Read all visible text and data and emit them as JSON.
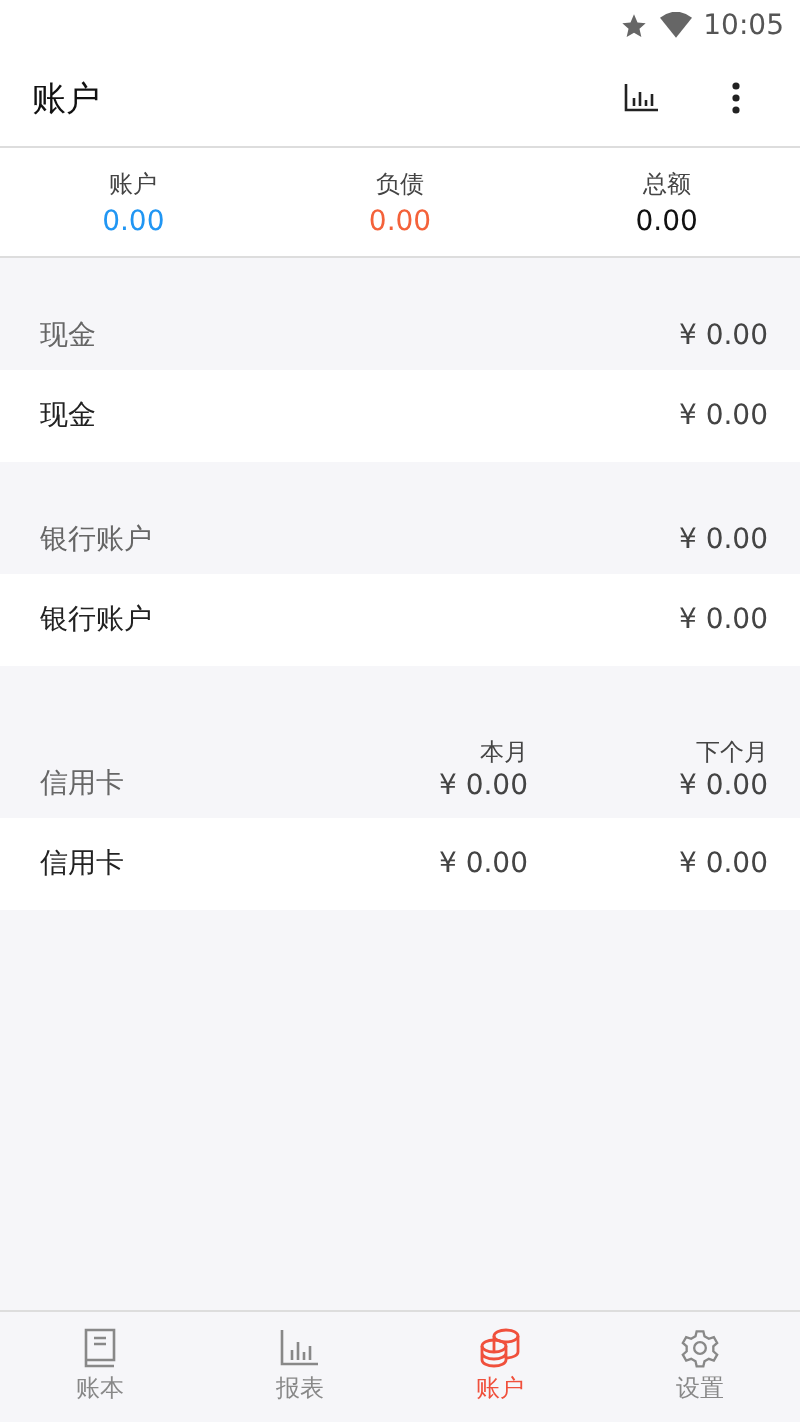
{
  "status_bar": {
    "time": "10:05"
  },
  "app_bar": {
    "title": "账户"
  },
  "summary": [
    {
      "label": "账户",
      "value": "0.00",
      "color": "#2196f3"
    },
    {
      "label": "负债",
      "value": "0.00",
      "color": "#f4623a"
    },
    {
      "label": "总额",
      "value": "0.00",
      "color": "#111111"
    }
  ],
  "groups": [
    {
      "kind": "simple",
      "title": "现金",
      "total": "¥ 0.00",
      "rows": [
        {
          "name": "现金",
          "amount": "¥ 0.00"
        }
      ]
    },
    {
      "kind": "simple",
      "title": "银行账户",
      "total": "¥ 0.00",
      "rows": [
        {
          "name": "银行账户",
          "amount": "¥ 0.00"
        }
      ]
    },
    {
      "kind": "credit",
      "title": "信用卡",
      "col_1": "本月",
      "col_2": "下个月",
      "total_1": "¥ 0.00",
      "total_2": "¥ 0.00",
      "rows": [
        {
          "name": "信用卡",
          "amount_1": "¥ 0.00",
          "amount_2": "¥ 0.00"
        }
      ]
    }
  ],
  "tabs": [
    {
      "label": "账本",
      "kind": "book",
      "selected": false
    },
    {
      "label": "报表",
      "kind": "chart",
      "selected": false
    },
    {
      "label": "账户",
      "kind": "coins",
      "selected": true
    },
    {
      "label": "设置",
      "kind": "gear",
      "selected": false
    }
  ]
}
